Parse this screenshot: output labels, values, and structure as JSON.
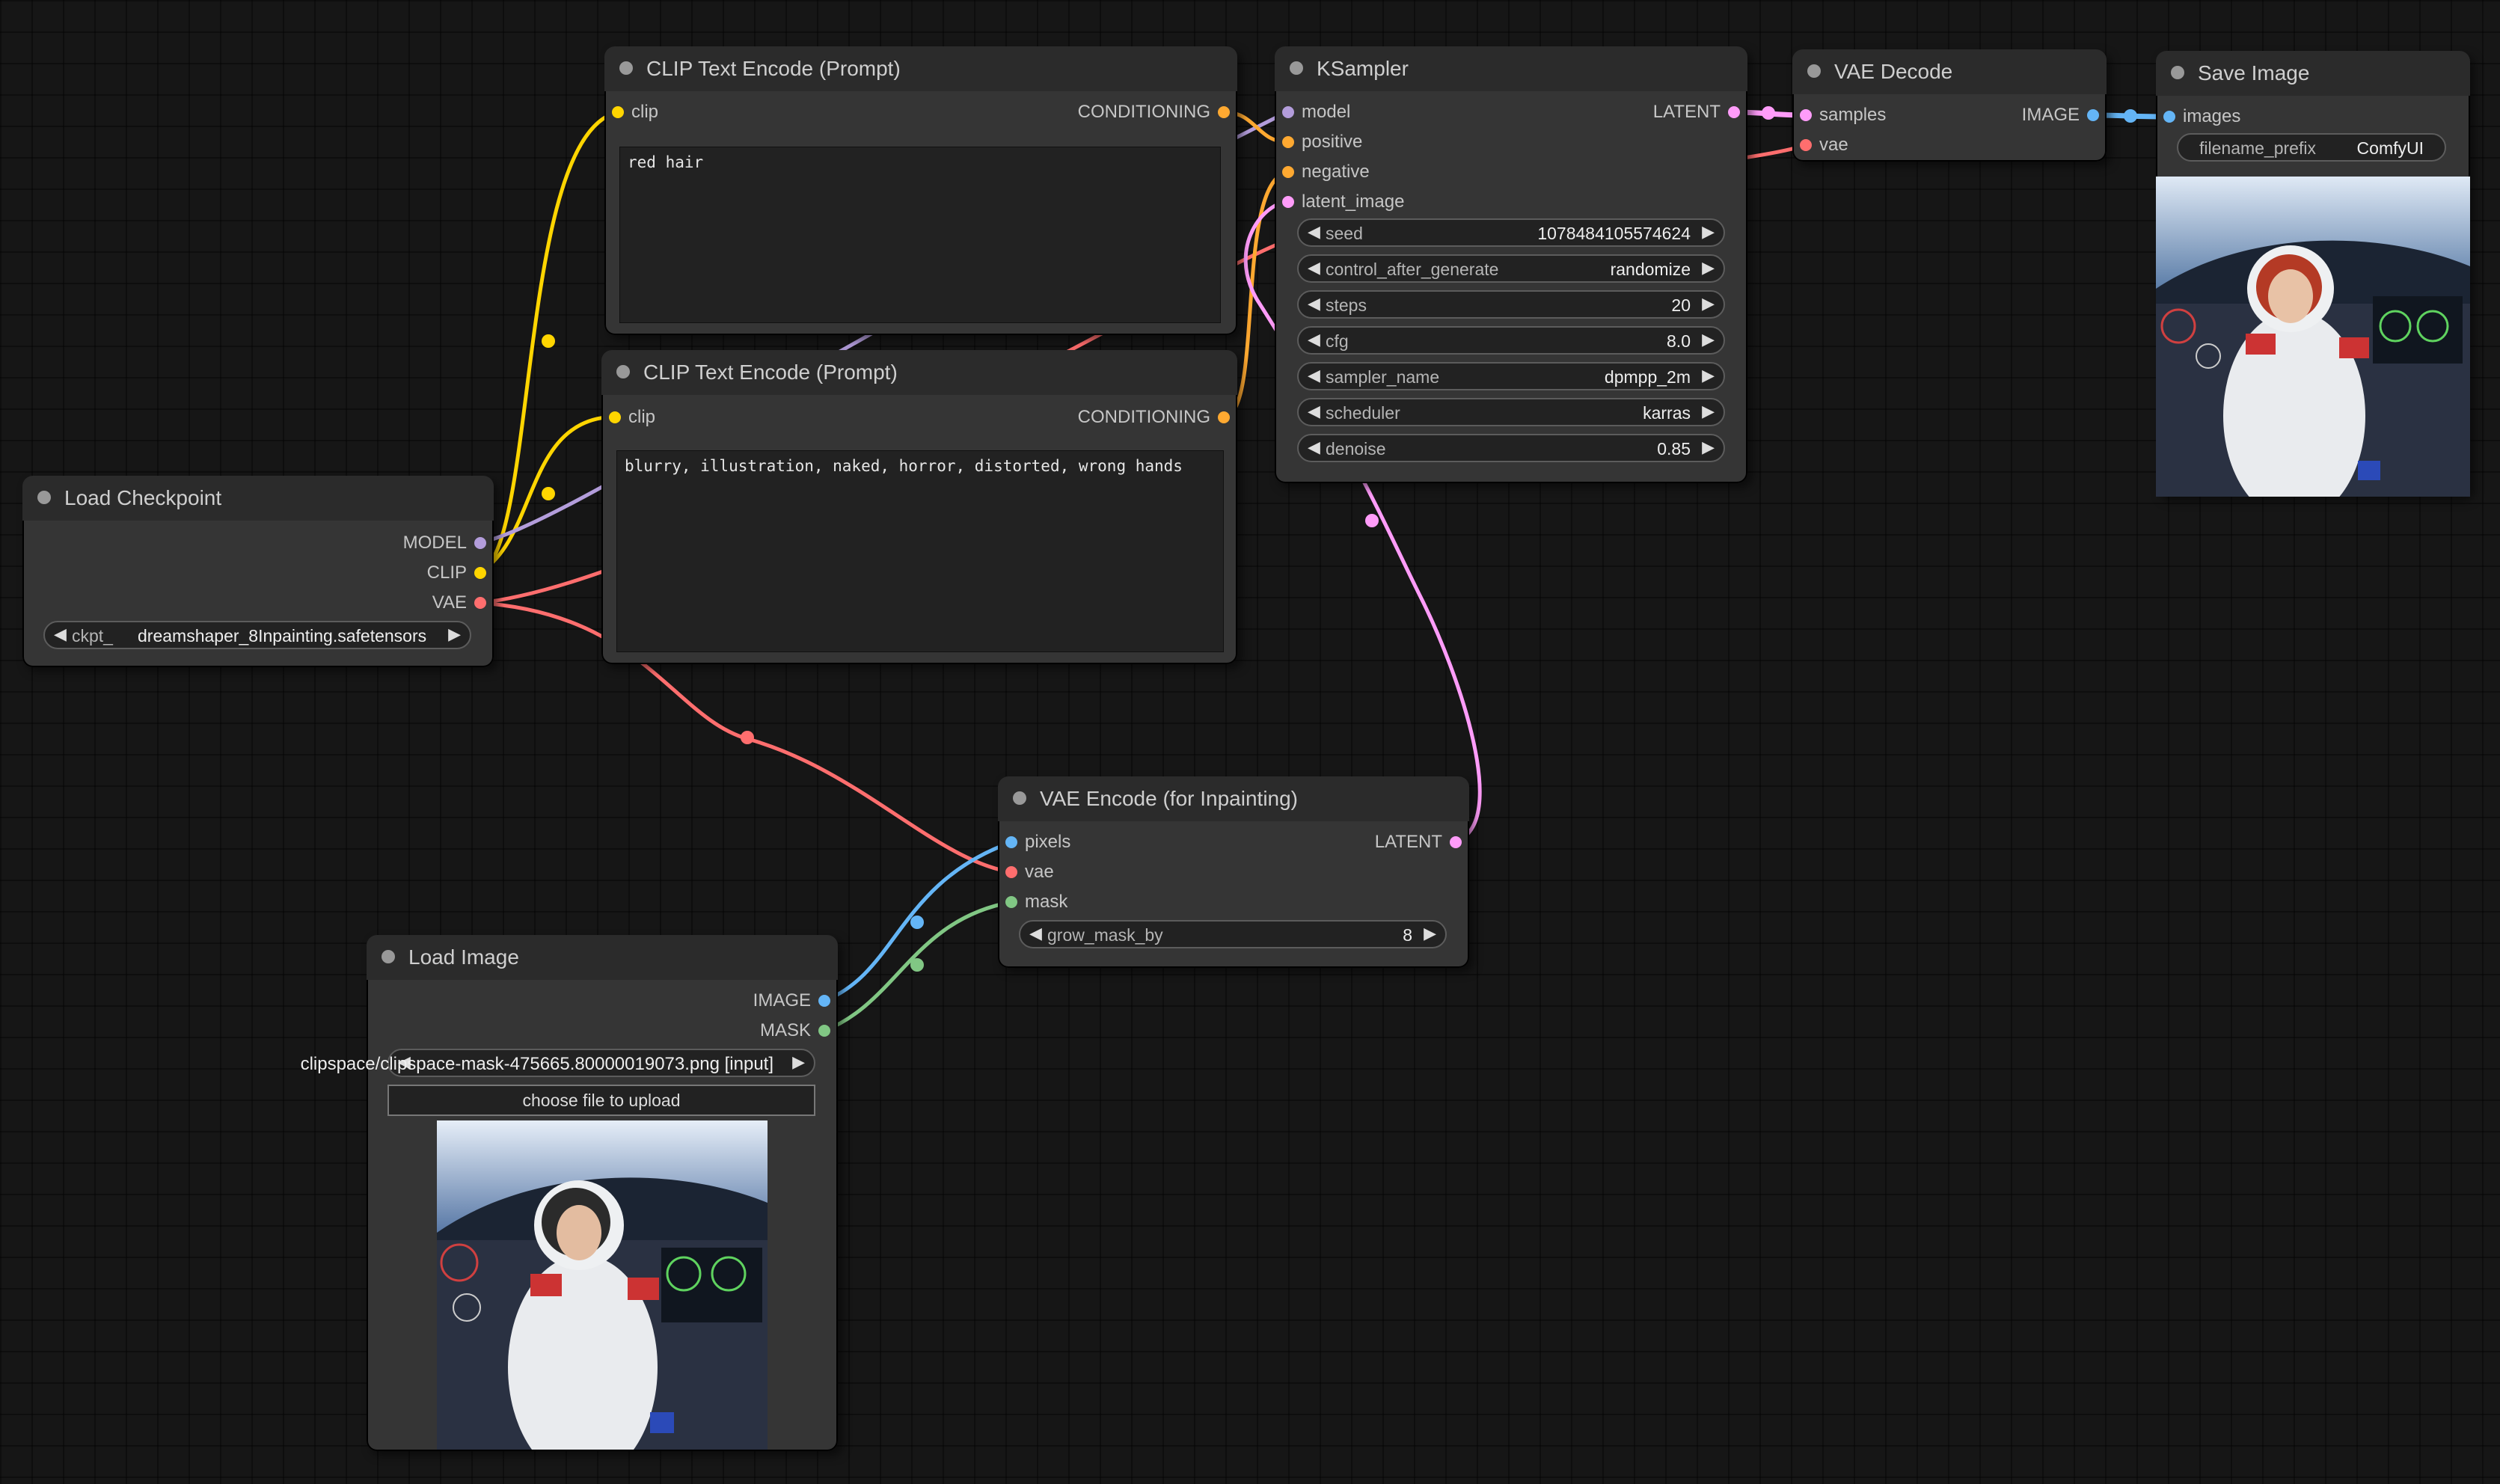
{
  "nodes": {
    "clip_text_encode_1": {
      "title": "CLIP Text Encode (Prompt)",
      "inputs": [
        "clip"
      ],
      "outputs": [
        "CONDITIONING"
      ],
      "text": "red hair"
    },
    "clip_text_encode_2": {
      "title": "CLIP Text Encode (Prompt)",
      "inputs": [
        "clip"
      ],
      "outputs": [
        "CONDITIONING"
      ],
      "text": "blurry, illustration, naked, horror, distorted, wrong hands"
    },
    "ksampler": {
      "title": "KSampler",
      "inputs": [
        "model",
        "positive",
        "negative",
        "latent_image"
      ],
      "outputs": [
        "LATENT"
      ],
      "widgets": [
        {
          "name": "seed",
          "value": "1078484105574624"
        },
        {
          "name": "control_after_generate",
          "value": "randomize"
        },
        {
          "name": "steps",
          "value": "20"
        },
        {
          "name": "cfg",
          "value": "8.0"
        },
        {
          "name": "sampler_name",
          "value": "dpmpp_2m"
        },
        {
          "name": "scheduler",
          "value": "karras"
        },
        {
          "name": "denoise",
          "value": "0.85"
        }
      ]
    },
    "vae_decode": {
      "title": "VAE Decode",
      "inputs": [
        "samples",
        "vae"
      ],
      "outputs": [
        "IMAGE"
      ]
    },
    "save_image": {
      "title": "Save Image",
      "inputs": [
        "images"
      ],
      "widget": {
        "name": "filename_prefix",
        "value": "ComfyUI"
      }
    },
    "load_checkpoint": {
      "title": "Load Checkpoint",
      "outputs": [
        "MODEL",
        "CLIP",
        "VAE"
      ],
      "widget": {
        "name": "ckpt_",
        "value": "dreamshaper_8Inpainting.safetensors"
      }
    },
    "vae_encode_inpaint": {
      "title": "VAE Encode (for Inpainting)",
      "inputs": [
        "pixels",
        "vae",
        "mask"
      ],
      "outputs": [
        "LATENT"
      ],
      "widget": {
        "name": "grow_mask_by",
        "value": "8"
      }
    },
    "load_image": {
      "title": "Load Image",
      "outputs": [
        "IMAGE",
        "MASK"
      ],
      "widget": {
        "name": "image",
        "value": "clipspace/clipspace-mask-475665.80000019073.png [input]"
      },
      "upload_label": "choose file to upload"
    }
  },
  "colors": {
    "clip": "#ffd500",
    "conditioning": "#ffa931",
    "model": "#b39ddb",
    "vae": "#ff6e6e",
    "latent": "#ff9cf9",
    "image": "#64b5f6",
    "mask": "#81c784"
  },
  "icons": {
    "arrow_left": "◀",
    "arrow_right": "▶"
  }
}
